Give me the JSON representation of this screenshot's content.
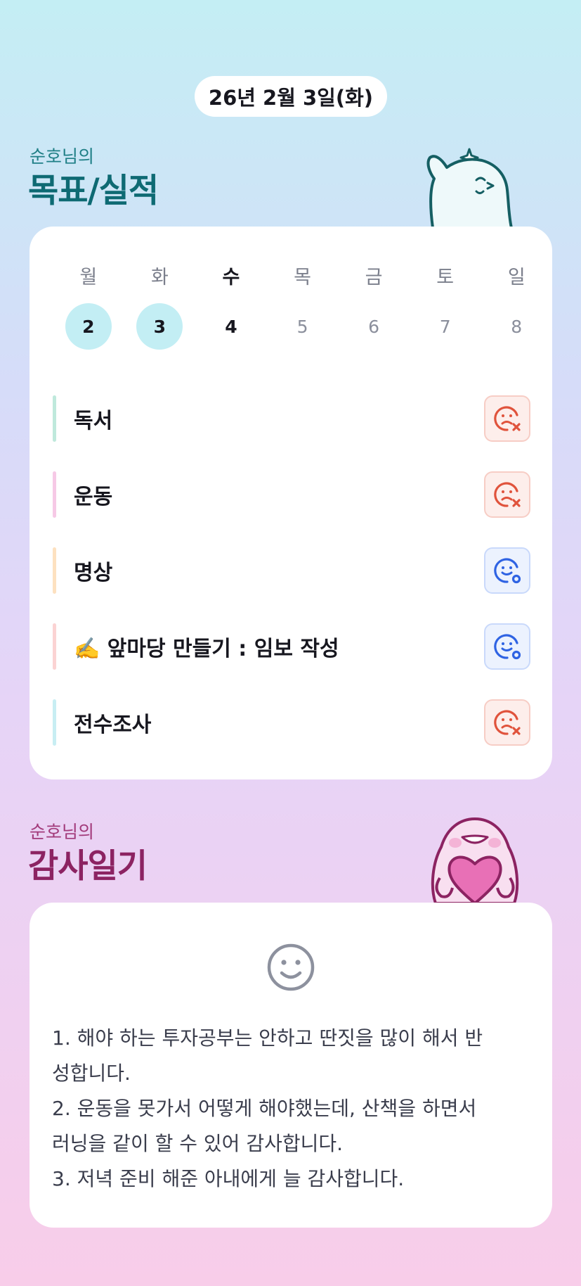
{
  "header": {
    "date": "26년 2월 3일(화)"
  },
  "goals": {
    "subtitle": "순호님의",
    "title": "목표/실적",
    "week": [
      {
        "day": "월",
        "num": "2",
        "state": "done"
      },
      {
        "day": "화",
        "num": "3",
        "state": "done"
      },
      {
        "day": "수",
        "num": "4",
        "state": "today"
      },
      {
        "day": "목",
        "num": "5",
        "state": "future"
      },
      {
        "day": "금",
        "num": "6",
        "state": "future"
      },
      {
        "day": "토",
        "num": "7",
        "state": "future"
      },
      {
        "day": "일",
        "num": "8",
        "state": "future"
      }
    ],
    "items": [
      {
        "label": "독서",
        "bar_color": "#bfe9dc",
        "status": "fail"
      },
      {
        "label": "운동",
        "bar_color": "#f6c9e6",
        "status": "fail"
      },
      {
        "label": "명상",
        "bar_color": "#fde1c0",
        "status": "success"
      },
      {
        "label": "✍️ 앞마당 만들기 : 임보 작성",
        "bar_color": "#fbd3d3",
        "status": "success"
      },
      {
        "label": "전수조사",
        "bar_color": "#c8eef3",
        "status": "fail"
      }
    ],
    "status_colors": {
      "fail": "#e0533c",
      "success": "#2f63e3"
    }
  },
  "gratitude": {
    "subtitle": "순호님의",
    "title": "감사일기",
    "lines": [
      "1. 해야 하는 투자공부는 안하고 딴짓을 많이 해서 반",
      "성합니다.",
      "2. 운동을 못가서 어떻게 해야했는데, 산책을 하면서",
      "러닝을 같이 할 수 있어 감사합니다.",
      "3. 저녁 준비 해준 아내에게 늘 감사합니다."
    ]
  }
}
